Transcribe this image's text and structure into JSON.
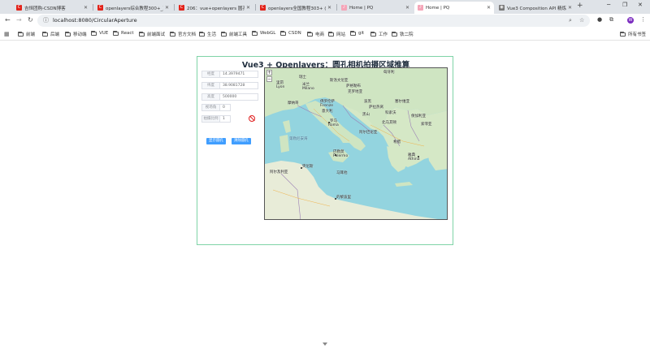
{
  "tabs": [
    {
      "title": "吉恒团购-CSDN博客",
      "color": "#e2231a",
      "glyph": "C"
    },
    {
      "title": "openlayers综合教程300+_正...",
      "color": "#e2231a",
      "glyph": "C"
    },
    {
      "title": "206：vue+openlayers 圆孔...",
      "color": "#e2231a",
      "glyph": "C"
    },
    {
      "title": "openlayers全国教程303+ (...",
      "color": "#e2231a",
      "glyph": "C"
    },
    {
      "title": "Home | PQ",
      "color": "#f5a5b8",
      "glyph": "♪"
    },
    {
      "title": "Home | PQ",
      "color": "#f5a5b8",
      "glyph": "♪"
    },
    {
      "title": "Vue3 Composition API 精炼",
      "color": "#777777",
      "glyph": "◉"
    }
  ],
  "toolbar": {
    "url": "localhost:8080/CircularAperture"
  },
  "bookmarks": [
    "前端",
    "后端",
    "移动端",
    "VUE",
    "React",
    "前端面试",
    "官方文档",
    "生活",
    "前端工具",
    "WebGL",
    "CSDN",
    "电商",
    "网站",
    "git",
    "工作",
    "铁二院"
  ],
  "bookmarks_right": "所有书签",
  "app": {
    "title": "Vue3 + Openlayers：圆孔相机拍摄区域推算",
    "fields": [
      {
        "label": "经度",
        "value": "14.3979471"
      },
      {
        "label": "纬度",
        "value": "38.9081728"
      },
      {
        "label": "高度",
        "value": "500000"
      },
      {
        "label": "视场角",
        "value": "0"
      },
      {
        "label": "拍摄比例",
        "value": "1"
      }
    ],
    "buttons": {
      "show_area": "显示圆孔",
      "clear_area": "清除圆孔"
    },
    "map": {
      "zoom_in": "+",
      "zoom_out": "−",
      "labels": [
        "匈牙利",
        "瑞士",
        "斯洛文尼亚",
        "里昂",
        "米兰",
        "萨格勒布",
        "Lyon",
        "Milano",
        "克罗地亚",
        "摩纳哥",
        "佛罗伦萨",
        "Firenze",
        "波黑",
        "塞尔维亚",
        "意大利",
        "萨拉热窝",
        "黑山",
        "科索沃",
        "罗马",
        "Roma",
        "阿尔巴尼亚",
        "北马其顿",
        "保加利亚",
        "希腊",
        "巴勒莫",
        "Palermo",
        "马耳他",
        "雅典",
        "Athina",
        "突尼斯",
        "的黎波里",
        "阿尔及利亚",
        "第勒尼安海",
        "索菲亚"
      ]
    }
  }
}
